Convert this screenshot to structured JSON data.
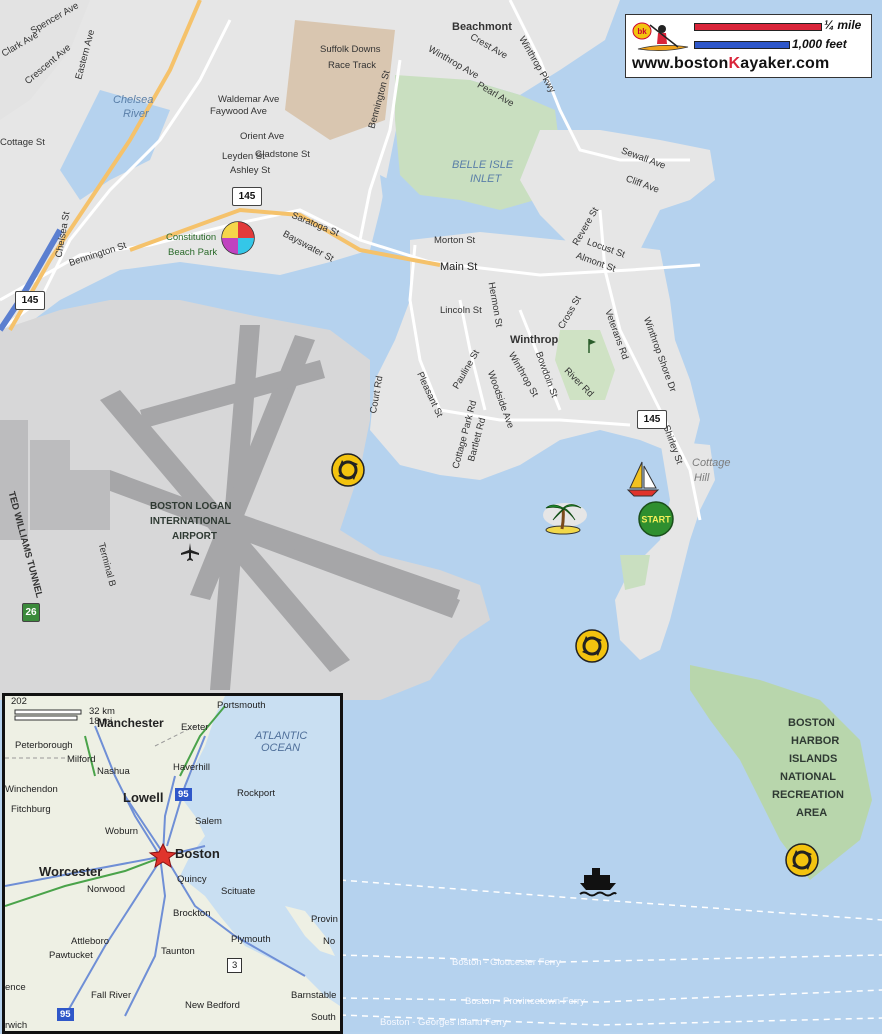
{
  "logo": {
    "badge": "bk",
    "scale_quarter_mile": "¼ mile",
    "scale_thousand_feet": "1,000 feet",
    "url_prefix": "www.boston",
    "url_k": "K",
    "url_suffix": "ayaker.com",
    "colors": {
      "mile_bar": "#d9253a",
      "feet_bar": "#2f57c9"
    }
  },
  "map_labels": {
    "beachmont": "Beachmont",
    "suffolk_downs": "Suffolk Downs",
    "race_track": "Race Track",
    "chelsea": "Chelsea",
    "river": "River",
    "belle_isle": "BELLE ISLE",
    "inlet": "INLET",
    "winthrop": "Winthrop",
    "constitution": "Constitution",
    "beach_park": "Beach Park",
    "cottage": "Cottage",
    "hill": "Hill",
    "airport_1": "BOSTON LOGAN",
    "airport_2": "INTERNATIONAL",
    "airport_3": "AIRPORT",
    "ted_williams": "TED WILLIAMS TUNNEL",
    "terminal_b": "Terminal B",
    "park_1": "BOSTON",
    "park_2": "HARBOR",
    "park_3": "ISLANDS",
    "park_4": "NATIONAL",
    "park_5": "RECREATION",
    "park_6": "AREA",
    "ferry_1": "Boston - Gloucester Ferry",
    "ferry_2": "Boston - Provincetown Ferry",
    "ferry_3": "Boston - Georges Island Ferry",
    "route_26": "26",
    "route_145": "145"
  },
  "streets": {
    "spencer": "Spencer Ave",
    "clark": "Clark Ave",
    "crescent": "Crescent Ave",
    "eastern": "Eastern Ave",
    "cottage": "Cottage St",
    "chelsea_st": "Chelsea St",
    "waldemar": "Waldemar Ave",
    "faywood": "Faywood Ave",
    "orient": "Orient Ave",
    "gladstone": "Gladstone St",
    "leyden": "Leyden St",
    "ashley": "Ashley St",
    "saratoga": "Saratoga St",
    "bayswater": "Bayswater St",
    "bennington": "Bennington St",
    "bennington2": "Bennington St",
    "crest": "Crest Ave",
    "winthrop_ave": "Winthrop Ave",
    "pearl": "Pearl Ave",
    "winthrop_pkwy": "Winthrop Pkwy",
    "sewall": "Sewall Ave",
    "cliff": "Cliff Ave",
    "morton": "Morton St",
    "main": "Main St",
    "revere": "Revere St",
    "locust": "Locust St",
    "almont": "Almont St",
    "lincoln": "Lincoln St",
    "hermon": "Hermon St",
    "cross": "Cross St",
    "veterans": "Veterans Rd",
    "winthrop_shore": "Winthrop Shore Dr",
    "court": "Court Rd",
    "pleasant": "Pleasant St",
    "pauline": "Pauline St",
    "woodside": "Woodside Ave",
    "winthrop_st": "Winthrop St",
    "bowdoin": "Bowdoin St",
    "river": "River Rd",
    "cottage_park": "Cottage Park Rd",
    "bartlett": "Bartlett Rd",
    "shirley": "Shirley St"
  },
  "markers": {
    "start": "START",
    "icons": [
      "beach-ball-icon",
      "roundabout-icon",
      "palm-island-icon",
      "sailboat-icon",
      "ferry-icon",
      "airplane-icon",
      "golf-flag-icon"
    ]
  },
  "inset": {
    "scale_km": "32 km",
    "scale_mi": "18 mi",
    "route_202": "202",
    "route_95a": "95",
    "route_95b": "95",
    "route_3": "3",
    "portsmouth": "Portsmouth",
    "manchester": "Manchester",
    "exeter": "Exeter",
    "atlantic": "ATLANTIC",
    "ocean": "OCEAN",
    "peterborough": "Peterborough",
    "milford": "Milford",
    "nashua": "Nashua",
    "haverhill": "Haverhill",
    "winchendon": "Winchendon",
    "lowell": "Lowell",
    "rockport": "Rockport",
    "fitchburg": "Fitchburg",
    "salem": "Salem",
    "woburn": "Woburn",
    "boston": "Boston",
    "worcester": "Worcester",
    "quincy": "Quincy",
    "norwood": "Norwood",
    "scituate": "Scituate",
    "brockton": "Brockton",
    "provin": "Provin",
    "plymouth": "Plymouth",
    "attleboro": "Attleboro",
    "pawtucket": "Pawtucket",
    "taunton": "Taunton",
    "no": "No",
    "fall_river": "Fall River",
    "new_bedford": "New Bedford",
    "barnstable": "Barnstable",
    "south": "South",
    "ence": "ence",
    "rwich": "rwich"
  }
}
